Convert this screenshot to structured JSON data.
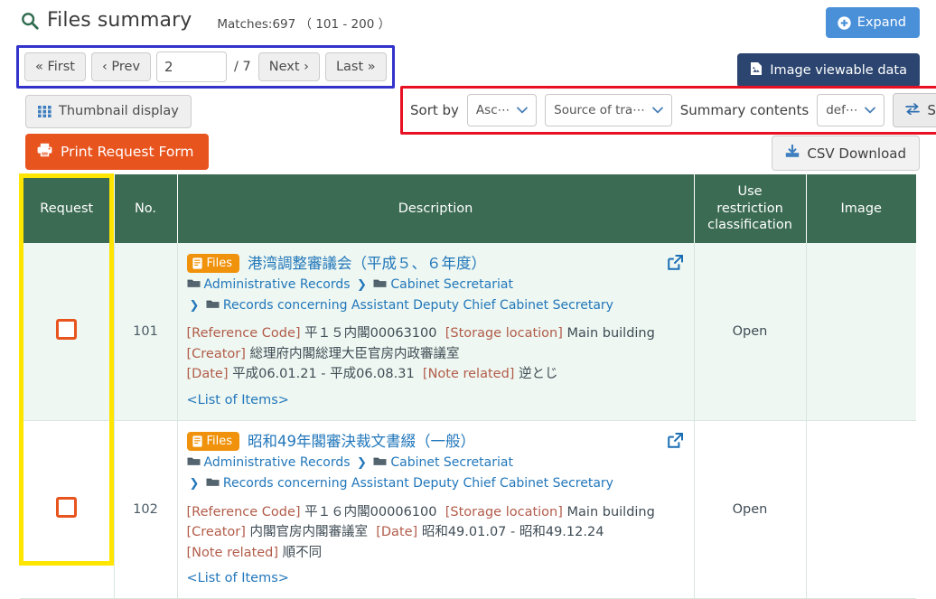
{
  "header": {
    "title": "Files summary",
    "search_icon": "search-icon",
    "matches": "Matches:697 （ 101 - 200 ）"
  },
  "toolbar": {
    "expand_label": "Expand",
    "expand_icon": "circle-plus-icon",
    "expand_color": "#4a90d9",
    "image_viewable_label": "Image viewable data",
    "image_viewable_icon": "image-file-icon",
    "image_viewable_color": "#2b4570",
    "thumbnail_label": "Thumbnail display",
    "thumbnail_icon": "grid-icon",
    "print_label": "Print Request Form",
    "print_icon": "printer-icon",
    "print_color": "#e8541e",
    "csv_label": "CSV Download",
    "csv_icon": "download-icon"
  },
  "pagination": {
    "first_label": "« First",
    "prev_label": "‹ Prev",
    "current_page": "2",
    "separator": "/ 7",
    "next_label": "Next ›",
    "last_label": "Last »",
    "highlight_color": "#3333cc"
  },
  "sort": {
    "sort_by_label": "Sort by",
    "order_value": "Asc⋯",
    "field_value": "Source of tra⋯",
    "summary_label": "Summary contents",
    "summary_value": "def⋯",
    "switch_label": "Switch",
    "switch_icon": "swap-icon",
    "highlight_color": "#e81123"
  },
  "table": {
    "header_color": "#3b6b52",
    "request_highlight_color": "#ffe500",
    "columns": [
      {
        "key": "request",
        "label": "Request"
      },
      {
        "key": "no",
        "label": "No."
      },
      {
        "key": "description",
        "label": "Description"
      },
      {
        "key": "use",
        "label": "Use\nrestriction\nclassification"
      },
      {
        "key": "image",
        "label": "Image"
      }
    ],
    "rows": [
      {
        "no": "101",
        "checkbox_icon": "checkbox-unchecked",
        "badge": "Files",
        "badge_icon": "document-icon",
        "title": "港湾調整審議会（平成５、６年度）",
        "external_link_icon": "external-link-icon",
        "crumb1": "Administrative Records",
        "crumb2": "Cabinet Secretariat",
        "crumb3": "Records concerning Assistant Deputy Chief Cabinet Secretary",
        "meta_line1_label1": "[Reference Code]",
        "meta_line1_value1": "平１５内閣00063100",
        "meta_line1_label2": "[Storage location]",
        "meta_line1_value2": "Main building",
        "meta_line2_label1": "[Creator]",
        "meta_line2_value1": "総理府内閣総理大臣官房内政審議室",
        "meta_line3_label1": "[Date]",
        "meta_line3_value1": "平成06.01.21 - 平成06.08.31",
        "meta_line3_label2": "[Note related]",
        "meta_line3_value2": "逆とじ",
        "items_link": "<List of Items>",
        "use_restriction": "Open",
        "image": ""
      },
      {
        "no": "102",
        "checkbox_icon": "checkbox-unchecked",
        "badge": "Files",
        "badge_icon": "document-icon",
        "title": "昭和49年閣審決裁文書綴（一般）",
        "external_link_icon": "external-link-icon",
        "crumb1": "Administrative Records",
        "crumb2": "Cabinet Secretariat",
        "crumb3": "Records concerning Assistant Deputy Chief Cabinet Secretary",
        "meta_line1_label1": "[Reference Code]",
        "meta_line1_value1": "平１６内閣00006100",
        "meta_line1_label2": "[Storage location]",
        "meta_line1_value2": "Main building",
        "meta_line2_label1": "[Creator]",
        "meta_line2_value1": "内閣官房内閣審議室",
        "meta_line2_label2": "[Date]",
        "meta_line2_value2": "昭和49.01.07 - 昭和49.12.24",
        "meta_line3_label1": "[Note related]",
        "meta_line3_value1": "順不同",
        "items_link": "<List of Items>",
        "use_restriction": "Open",
        "image": ""
      }
    ]
  }
}
